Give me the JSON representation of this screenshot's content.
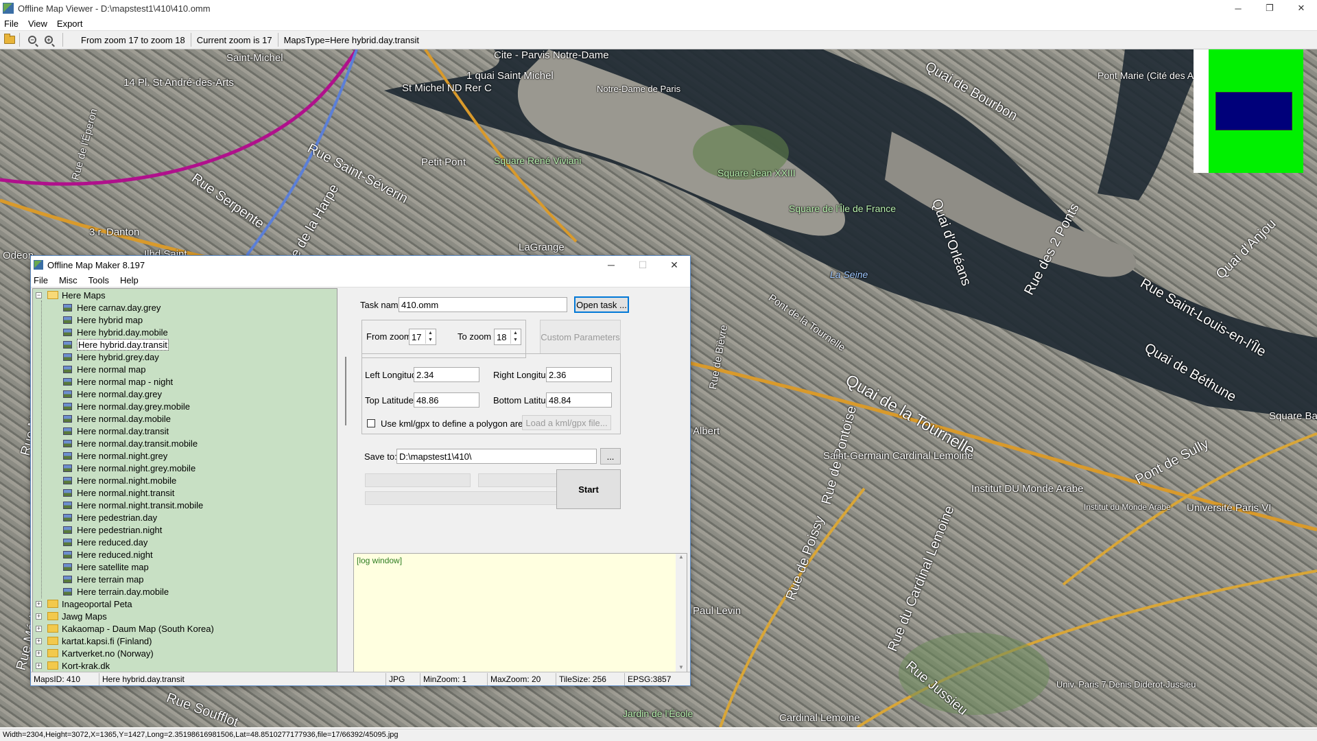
{
  "window": {
    "title": "Offline Map Viewer - D:\\mapstest1\\410\\410.omm",
    "controls": {
      "minimize": "─",
      "maximize": "❐",
      "close": "✕"
    }
  },
  "menubar": {
    "items": [
      "File",
      "View",
      "Export"
    ]
  },
  "toolbar": {
    "zoom_range": "From zoom 17 to zoom 18",
    "current_zoom": "Current zoom is 17",
    "maps_type": "MapsType=Here hybrid.day.transit"
  },
  "map": {
    "labels": [
      "Saint-Michel",
      "Cite - Parvis Notre-Dame",
      "14 Pl. St André-des-Arts",
      "1 quai Saint Michel",
      "St Michel ND Rer C",
      "Notre-Dame de Paris",
      "Quai de Bourbon",
      "Pont Marie (Cité des Arts)",
      "Rue de l'Éperon",
      "Rue Saint-Séverin",
      "Petit Pont",
      "Square René Viviani",
      "Square Jean XXIII",
      "Rue Serpente",
      "3 r. Danton",
      "Rue de la Harpe",
      "LaGrange",
      "Square de l'Île de France",
      "La Seine",
      "Quai d'Orléans",
      "Rue des 2 Ponts",
      "Quai d'Anjou",
      "Rue Saint-Louis-en-l'Île",
      "Quai de Béthune",
      "Quai de la Tournelle",
      "Pont de la Tournelle",
      "Rue de Pontoise",
      "Rue de Bièvre",
      "Pont de Sully",
      "Saint-Germain Cardinal Lemoine",
      "Institut DU Monde Arabe",
      "Rue de Poissy",
      "Rue du Cardinal Lemoine",
      "Université Paris VI",
      "Rue Soufflot",
      "Univ. Paris 7 Denis Diderot-Jussieu",
      "Rue Jussieu",
      "Jardin de l'École",
      "Cardinal Lemoine",
      "Square Barye",
      "Odeon",
      "Paul Levin",
      "Institut du Monde Arabe",
      "Rue Monsieur le Prince",
      "Rue Médicis",
      "Albert",
      "Ilbd Saint"
    ]
  },
  "dialog": {
    "title": "Offline Map Maker 8.197",
    "controls": {
      "minimize": "─",
      "maximize": "☐",
      "close": "✕"
    },
    "menu": [
      "File",
      "Misc",
      "Tools",
      "Help"
    ],
    "tree": {
      "root": "Here Maps",
      "children": [
        "Here carnav.day.grey",
        "Here hybrid map",
        "Here hybrid.day.mobile",
        "Here hybrid.day.transit",
        "Here hybrid.grey.day",
        "Here normal map",
        "Here normal map - night",
        "Here normal.day.grey",
        "Here normal.day.grey.mobile",
        "Here normal.day.mobile",
        "Here normal.day.transit",
        "Here normal.day.transit.mobile",
        "Here normal.night.grey",
        "Here normal.night.grey.mobile",
        "Here normal.night.mobile",
        "Here normal.night.transit",
        "Here normal.night.transit.mobile",
        "Here pedestrian.day",
        "Here pedestrian.night",
        "Here reduced.day",
        "Here reduced.night",
        "Here satellite map",
        "Here terrain map",
        "Here terrain.day.mobile"
      ],
      "selected": "Here hybrid.day.transit",
      "others": [
        "Inageoportal Peta",
        "Jawg Maps",
        "Kakaomap - Daum Map (South Korea)",
        "kartat.kapsi.fi (Finland)",
        "Kartverket.no (Norway)",
        "Kort-krak.dk"
      ]
    },
    "task": {
      "label": "Task name",
      "value": "410.omm",
      "open_button": "Open task ..."
    },
    "zoom": {
      "from_label": "From zoom",
      "from_value": "17",
      "to_label": "To zoom",
      "to_value": "18",
      "custom_button": "Custom Parameters"
    },
    "coords": {
      "left_lon_label": "Left Longitude",
      "left_lon": "2.34",
      "right_lon_label": "Right Longitude",
      "right_lon": "2.36",
      "top_lat_label": "Top Latitude",
      "top_lat": "48.86",
      "bottom_lat_label": "Bottom Latitude",
      "bottom_lat": "48.84",
      "kml_label": "Use kml/gpx to define a polygon area",
      "kml_button": "Load a kml/gpx file..."
    },
    "save": {
      "label": "Save to:",
      "value": "D:\\mapstest1\\410\\",
      "browse": "..."
    },
    "start_button": "Start",
    "log": "[log window]",
    "status": {
      "maps_id": "MapsID: 410",
      "map_name": "Here hybrid.day.transit",
      "format": "JPG",
      "min_zoom": "MinZoom: 1",
      "max_zoom": "MaxZoom: 20",
      "tile_size": "TileSize: 256",
      "epsg": "EPSG:3857"
    }
  },
  "statusbar": "Width=2304,Height=3072,X=1365,Y=1427,Long=2.35198616981506,Lat=48.8510277177936,file=17/66392/45095.jpg"
}
